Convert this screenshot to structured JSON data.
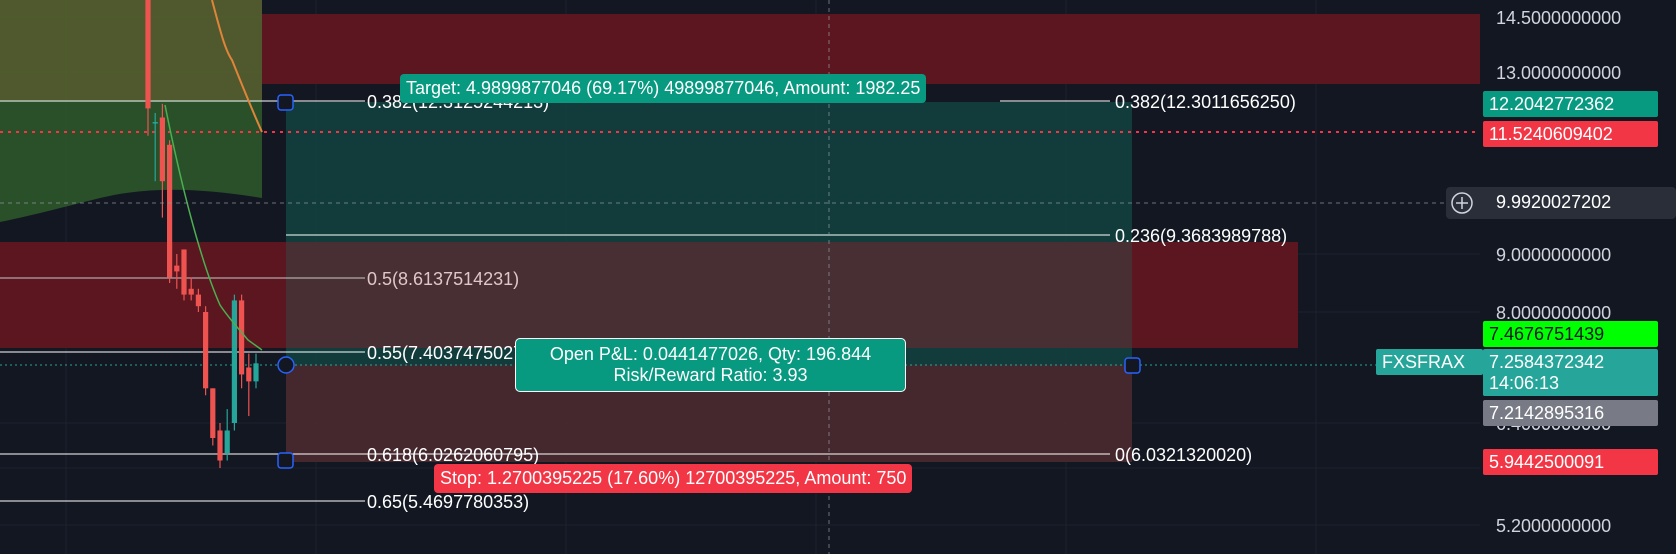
{
  "chart_data": {
    "type": "candlestick",
    "symbol": "FXSFRAX",
    "countdown": "14:06:13",
    "y_axis_ticks": [
      "14.5000000000",
      "13.0000000000",
      "9.0000000000",
      "8.0000000000",
      "6.4000000000",
      "5.8000000000",
      "5.2000000000"
    ],
    "y_axis_tick_values": [
      14.5,
      13.0,
      9.0,
      8.0,
      6.4,
      5.8,
      5.2
    ],
    "price_tags": [
      {
        "id": "target",
        "text": "12.2042772362",
        "value": 12.2042772362,
        "color": "#089981"
      },
      {
        "id": "entry-line",
        "text": "11.5240609402",
        "value": 11.5240609402,
        "color": "#f23645"
      },
      {
        "id": "crosshair",
        "text": "9.9920027202",
        "value": 9.9920027202,
        "color": "#363a45"
      },
      {
        "id": "high",
        "text": "7.4676751439",
        "value": 7.4676751439,
        "color": "#00ff00"
      },
      {
        "id": "last",
        "text": "7.2584372342",
        "value": 7.2584372342,
        "color": "#26a69a"
      },
      {
        "id": "low",
        "text": "7.2142895316",
        "value": 7.2142895316,
        "color": "#787b86"
      },
      {
        "id": "stop",
        "text": "5.9442500091",
        "value": 5.9442500091,
        "color": "#f23645"
      }
    ],
    "fib_left": [
      {
        "label": "0.382(12.3125244213)",
        "value": 12.3125244213
      },
      {
        "label": "0.5(8.6137514231)",
        "value": 8.6137514231
      },
      {
        "label": "0.55(7.4037475027)",
        "value": 7.4037475027
      },
      {
        "label": "0.618(6.0262060795)",
        "value": 6.0262060795
      },
      {
        "label": "0.65(5.4697780353)",
        "value": 5.4697780353
      }
    ],
    "fib_right": [
      {
        "label": "0.382(12.3011656250)",
        "value": 12.301165625
      },
      {
        "label": "0.236(9.3683989788)",
        "value": 9.3683989788
      },
      {
        "label": "0(6.0321320020)",
        "value": 6.032132002
      }
    ],
    "candles": [
      {
        "o": 18.0,
        "h": 20.0,
        "l": 11.6,
        "c": 12.2
      },
      {
        "o": 11.9,
        "h": 12.1,
        "l": 10.6,
        "c": 11.9
      },
      {
        "o": 12.0,
        "h": 12.3,
        "l": 9.8,
        "c": 10.6
      },
      {
        "o": 11.4,
        "h": 11.5,
        "l": 8.5,
        "c": 8.6
      },
      {
        "o": 8.8,
        "h": 9.0,
        "l": 8.4,
        "c": 8.7
      },
      {
        "o": 9.1,
        "h": 9.1,
        "l": 8.2,
        "c": 8.3
      },
      {
        "o": 8.4,
        "h": 8.6,
        "l": 8.2,
        "c": 8.3
      },
      {
        "o": 8.3,
        "h": 8.4,
        "l": 8.0,
        "c": 8.1
      },
      {
        "o": 8.0,
        "h": 8.1,
        "l": 6.8,
        "c": 6.9
      },
      {
        "o": 6.9,
        "h": 6.9,
        "l": 6.1,
        "c": 6.2
      },
      {
        "o": 6.3,
        "h": 6.4,
        "l": 5.8,
        "c": 5.9
      },
      {
        "o": 6.0,
        "h": 6.6,
        "l": 5.9,
        "c": 6.3
      },
      {
        "o": 6.4,
        "h": 8.3,
        "l": 6.3,
        "c": 8.2
      },
      {
        "o": 8.2,
        "h": 8.3,
        "l": 6.9,
        "c": 7.1
      },
      {
        "o": 7.2,
        "h": 7.4,
        "l": 6.5,
        "c": 7.0
      },
      {
        "o": 7.0,
        "h": 7.4,
        "l": 6.9,
        "c": 7.26
      }
    ],
    "position": {
      "target_text": "Target: 4.9899877046 (69.17%) 49899877046, Amount: 1982.25",
      "stop_text": "Stop: 1.2700395225 (17.60%) 12700395225, Amount: 750",
      "pnl_line1": "Open P&L: 0.0441477026, Qty: 196.844",
      "pnl_line2": "Risk/Reward Ratio: 3.93",
      "entry": 7.2142895316,
      "target": 12.2042772362,
      "stop": 5.9442500091
    },
    "colors": {
      "up": "#26a69a",
      "down": "#ef5350",
      "profit": "#089981",
      "loss": "#f23645",
      "background": "#131722"
    }
  }
}
